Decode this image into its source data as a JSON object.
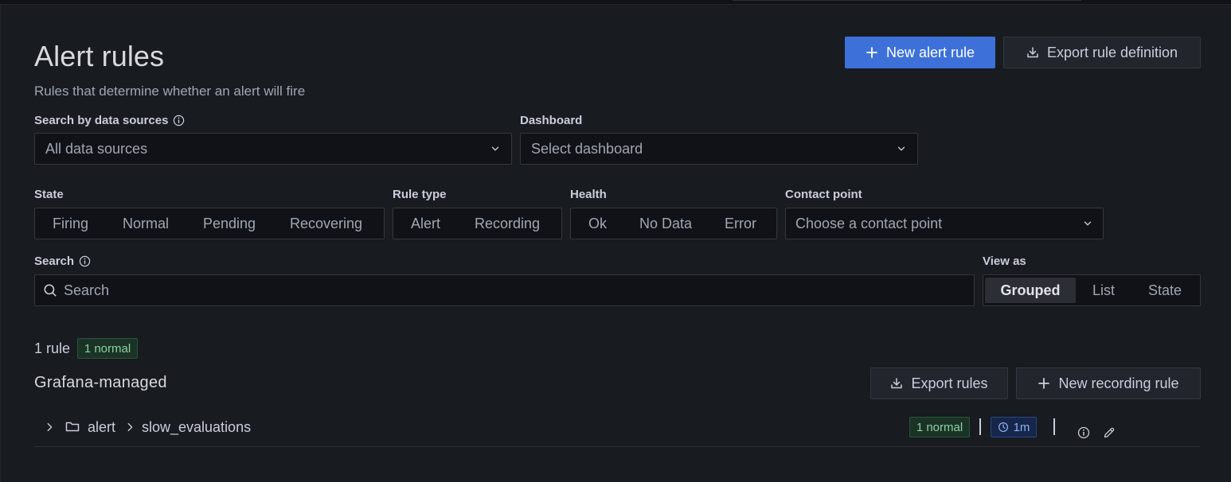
{
  "header": {
    "title": "Alert rules",
    "subtitle": "Rules that determine whether an alert will fire",
    "new_rule_button": "New alert rule",
    "export_definition_button": "Export rule definition"
  },
  "filters": {
    "data_sources": {
      "label": "Search by data sources",
      "value": "All data sources"
    },
    "dashboard": {
      "label": "Dashboard",
      "value": "Select dashboard"
    },
    "state": {
      "label": "State",
      "options": [
        "Firing",
        "Normal",
        "Pending",
        "Recovering"
      ]
    },
    "rule_type": {
      "label": "Rule type",
      "options": [
        "Alert",
        "Recording"
      ]
    },
    "health": {
      "label": "Health",
      "options": [
        "Ok",
        "No Data",
        "Error"
      ]
    },
    "contact_point": {
      "label": "Contact point",
      "value": "Choose a contact point"
    },
    "search": {
      "label": "Search",
      "placeholder": "Search"
    },
    "view_as": {
      "label": "View as",
      "options": [
        "Grouped",
        "List",
        "State"
      ],
      "selected": "Grouped"
    }
  },
  "summary": {
    "count_text": "1 rule",
    "badge": "1 normal"
  },
  "section": {
    "title": "Grafana-managed",
    "export_button": "Export rules",
    "new_recording_button": "New recording rule"
  },
  "group": {
    "folder": "alert",
    "name": "slow_evaluations",
    "badge": "1 normal",
    "interval": "1m"
  },
  "colors": {
    "background": "#181b1f",
    "primary": "#3d71d9",
    "normal_badge": "#1b3326",
    "interval_badge": "#16264a"
  },
  "icons": [
    "plus-icon",
    "download-icon",
    "info-icon",
    "chevron-down-icon",
    "search-icon",
    "chevron-right-icon",
    "folder-icon",
    "clock-icon",
    "edit-icon"
  ]
}
